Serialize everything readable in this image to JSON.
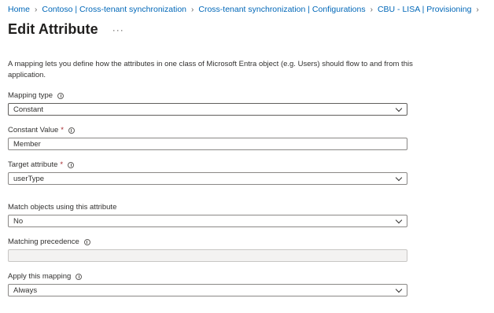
{
  "breadcrumb": [
    "Home",
    "Contoso | Cross-tenant synchronization",
    "Cross-tenant synchronization | Configurations",
    "CBU - LISA | Provisioning"
  ],
  "title": "Edit Attribute",
  "more": "···",
  "description": "A mapping lets you define how the attributes in one class of Microsoft Entra object (e.g. Users) should flow to and from this application.",
  "fields": {
    "mapping_type": {
      "label": "Mapping type",
      "value": "Constant"
    },
    "constant_value": {
      "label": "Constant Value",
      "required": "*",
      "value": "Member"
    },
    "target_attribute": {
      "label": "Target attribute",
      "required": "*",
      "value": "userType"
    },
    "match_objects": {
      "label": "Match objects using this attribute",
      "value": "No"
    },
    "matching_precedence": {
      "label": "Matching precedence",
      "value": ""
    },
    "apply_mapping": {
      "label": "Apply this mapping",
      "value": "Always"
    }
  }
}
